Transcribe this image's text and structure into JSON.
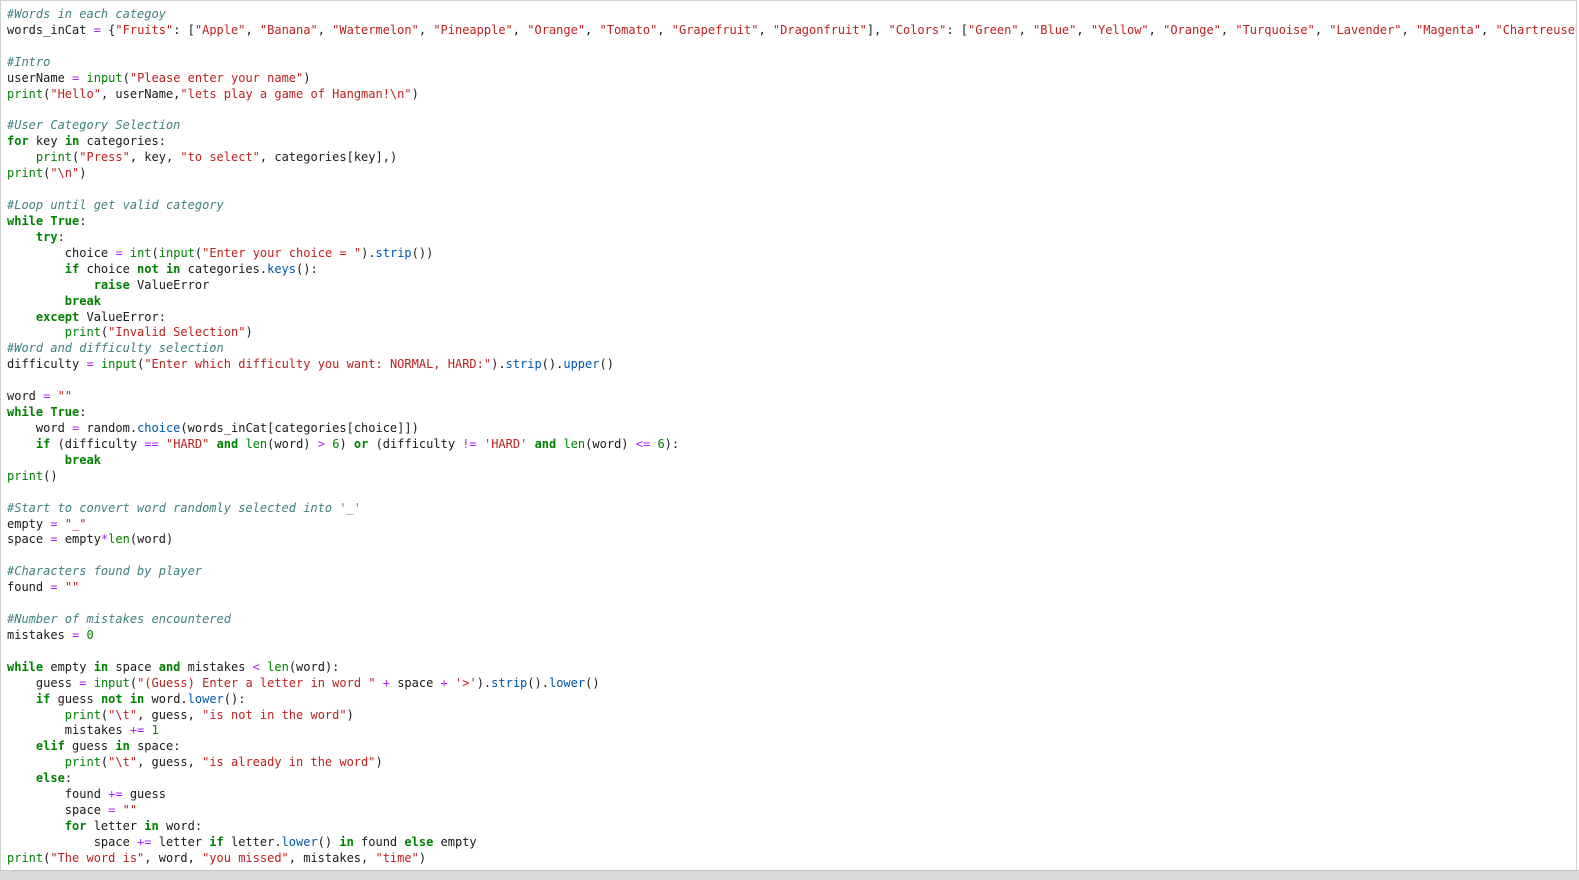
{
  "editor": {
    "lines": [
      [
        [
          "com",
          "#Words in each categoy"
        ]
      ],
      [
        [
          "id",
          "words_inCat "
        ],
        [
          "op",
          "="
        ],
        [
          "id",
          " {"
        ],
        [
          "str",
          "\"Fruits\""
        ],
        [
          "id",
          ": ["
        ],
        [
          "str",
          "\"Apple\""
        ],
        [
          "id",
          ", "
        ],
        [
          "str",
          "\"Banana\""
        ],
        [
          "id",
          ", "
        ],
        [
          "str",
          "\"Watermelon\""
        ],
        [
          "id",
          ", "
        ],
        [
          "str",
          "\"Pineapple\""
        ],
        [
          "id",
          ", "
        ],
        [
          "str",
          "\"Orange\""
        ],
        [
          "id",
          ", "
        ],
        [
          "str",
          "\"Tomato\""
        ],
        [
          "id",
          ", "
        ],
        [
          "str",
          "\"Grapefruit\""
        ],
        [
          "id",
          ", "
        ],
        [
          "str",
          "\"Dragonfruit\""
        ],
        [
          "id",
          "], "
        ],
        [
          "str",
          "\"Colors\""
        ],
        [
          "id",
          ": ["
        ],
        [
          "str",
          "\"Green\""
        ],
        [
          "id",
          ", "
        ],
        [
          "str",
          "\"Blue\""
        ],
        [
          "id",
          ", "
        ],
        [
          "str",
          "\"Yellow\""
        ],
        [
          "id",
          ", "
        ],
        [
          "str",
          "\"Orange\""
        ],
        [
          "id",
          ", "
        ],
        [
          "str",
          "\"Turquoise\""
        ],
        [
          "id",
          ", "
        ],
        [
          "str",
          "\"Lavender\""
        ],
        [
          "id",
          ", "
        ],
        [
          "str",
          "\"Magenta\""
        ],
        [
          "id",
          ", "
        ],
        [
          "str",
          "\"Chartreuse\""
        ],
        [
          "id",
          "]}"
        ]
      ],
      [],
      [
        [
          "com",
          "#Intro"
        ]
      ],
      [
        [
          "id",
          "userName "
        ],
        [
          "op",
          "="
        ],
        [
          "id",
          " "
        ],
        [
          "bi",
          "input"
        ],
        [
          "id",
          "("
        ],
        [
          "str",
          "\"Please enter your name\""
        ],
        [
          "id",
          ")"
        ]
      ],
      [
        [
          "bi",
          "print"
        ],
        [
          "id",
          "("
        ],
        [
          "str",
          "\"Hello\""
        ],
        [
          "id",
          ", userName,"
        ],
        [
          "str",
          "\"lets play a game of Hangman!\\n\""
        ],
        [
          "id",
          ")"
        ]
      ],
      [],
      [
        [
          "com",
          "#User Category Selection"
        ]
      ],
      [
        [
          "kw",
          "for"
        ],
        [
          "id",
          " key "
        ],
        [
          "kw",
          "in"
        ],
        [
          "id",
          " categories:"
        ]
      ],
      [
        [
          "id",
          "    "
        ],
        [
          "bi",
          "print"
        ],
        [
          "id",
          "("
        ],
        [
          "str",
          "\"Press\""
        ],
        [
          "id",
          ", key, "
        ],
        [
          "str",
          "\"to select\""
        ],
        [
          "id",
          ", categories[key],)"
        ]
      ],
      [
        [
          "bi",
          "print"
        ],
        [
          "id",
          "("
        ],
        [
          "str",
          "\"\\n\""
        ],
        [
          "id",
          ")"
        ]
      ],
      [],
      [
        [
          "com",
          "#Loop until get valid category"
        ]
      ],
      [
        [
          "kw",
          "while"
        ],
        [
          "id",
          " "
        ],
        [
          "kw",
          "True"
        ],
        [
          "id",
          ":"
        ]
      ],
      [
        [
          "id",
          "    "
        ],
        [
          "kw",
          "try"
        ],
        [
          "id",
          ":"
        ]
      ],
      [
        [
          "id",
          "        choice "
        ],
        [
          "op",
          "="
        ],
        [
          "id",
          " "
        ],
        [
          "bi",
          "int"
        ],
        [
          "id",
          "("
        ],
        [
          "bi",
          "input"
        ],
        [
          "id",
          "("
        ],
        [
          "str",
          "\"Enter your choice = \""
        ],
        [
          "id",
          ")."
        ],
        [
          "meth",
          "strip"
        ],
        [
          "id",
          "())"
        ]
      ],
      [
        [
          "id",
          "        "
        ],
        [
          "kw",
          "if"
        ],
        [
          "id",
          " choice "
        ],
        [
          "kw",
          "not in"
        ],
        [
          "id",
          " categories."
        ],
        [
          "meth",
          "keys"
        ],
        [
          "id",
          "():"
        ]
      ],
      [
        [
          "id",
          "            "
        ],
        [
          "kw",
          "raise"
        ],
        [
          "id",
          " ValueError"
        ]
      ],
      [
        [
          "id",
          "        "
        ],
        [
          "kw",
          "break"
        ]
      ],
      [
        [
          "id",
          "    "
        ],
        [
          "kw",
          "except"
        ],
        [
          "id",
          " ValueError:"
        ]
      ],
      [
        [
          "id",
          "        "
        ],
        [
          "bi",
          "print"
        ],
        [
          "id",
          "("
        ],
        [
          "str",
          "\"Invalid Selection\""
        ],
        [
          "id",
          ")"
        ]
      ],
      [
        [
          "com",
          "#Word and difficulty selection"
        ]
      ],
      [
        [
          "id",
          "difficulty "
        ],
        [
          "op",
          "="
        ],
        [
          "id",
          " "
        ],
        [
          "bi",
          "input"
        ],
        [
          "id",
          "("
        ],
        [
          "str",
          "\"Enter which difficulty you want: NORMAL, HARD:\""
        ],
        [
          "id",
          ")."
        ],
        [
          "meth",
          "strip"
        ],
        [
          "id",
          "()."
        ],
        [
          "meth",
          "upper"
        ],
        [
          "id",
          "()"
        ]
      ],
      [],
      [
        [
          "id",
          "word "
        ],
        [
          "op",
          "="
        ],
        [
          "id",
          " "
        ],
        [
          "str",
          "\"\""
        ]
      ],
      [
        [
          "kw",
          "while"
        ],
        [
          "id",
          " "
        ],
        [
          "kw",
          "True"
        ],
        [
          "id",
          ":"
        ]
      ],
      [
        [
          "id",
          "    word "
        ],
        [
          "op",
          "="
        ],
        [
          "id",
          " random."
        ],
        [
          "meth",
          "choice"
        ],
        [
          "id",
          "(words_inCat[categories[choice]])"
        ]
      ],
      [
        [
          "id",
          "    "
        ],
        [
          "kw",
          "if"
        ],
        [
          "id",
          " (difficulty "
        ],
        [
          "op",
          "=="
        ],
        [
          "id",
          " "
        ],
        [
          "str",
          "\"HARD\""
        ],
        [
          "id",
          " "
        ],
        [
          "kw",
          "and"
        ],
        [
          "id",
          " "
        ],
        [
          "bi",
          "len"
        ],
        [
          "id",
          "(word) "
        ],
        [
          "op",
          ">"
        ],
        [
          "id",
          " "
        ],
        [
          "num",
          "6"
        ],
        [
          "id",
          ") "
        ],
        [
          "kw",
          "or"
        ],
        [
          "id",
          " (difficulty "
        ],
        [
          "op",
          "!="
        ],
        [
          "id",
          " "
        ],
        [
          "str",
          "'HARD'"
        ],
        [
          "id",
          " "
        ],
        [
          "kw",
          "and"
        ],
        [
          "id",
          " "
        ],
        [
          "bi",
          "len"
        ],
        [
          "id",
          "(word) "
        ],
        [
          "op",
          "<="
        ],
        [
          "id",
          " "
        ],
        [
          "num",
          "6"
        ],
        [
          "id",
          "):"
        ]
      ],
      [
        [
          "id",
          "        "
        ],
        [
          "kw",
          "break"
        ]
      ],
      [
        [
          "bi",
          "print"
        ],
        [
          "id",
          "()"
        ]
      ],
      [],
      [
        [
          "com",
          "#Start to convert word randomly selected into '_'"
        ]
      ],
      [
        [
          "id",
          "empty "
        ],
        [
          "op",
          "="
        ],
        [
          "id",
          " "
        ],
        [
          "str",
          "\"_\""
        ]
      ],
      [
        [
          "id",
          "space "
        ],
        [
          "op",
          "="
        ],
        [
          "id",
          " empty"
        ],
        [
          "op",
          "*"
        ],
        [
          "bi",
          "len"
        ],
        [
          "id",
          "(word)"
        ]
      ],
      [],
      [
        [
          "com",
          "#Characters found by player"
        ]
      ],
      [
        [
          "id",
          "found "
        ],
        [
          "op",
          "="
        ],
        [
          "id",
          " "
        ],
        [
          "str",
          "\"\""
        ]
      ],
      [],
      [
        [
          "com",
          "#Number of mistakes encountered"
        ]
      ],
      [
        [
          "id",
          "mistakes "
        ],
        [
          "op",
          "="
        ],
        [
          "id",
          " "
        ],
        [
          "num",
          "0"
        ]
      ],
      [],
      [
        [
          "kw",
          "while"
        ],
        [
          "id",
          " empty "
        ],
        [
          "kw",
          "in"
        ],
        [
          "id",
          " space "
        ],
        [
          "kw",
          "and"
        ],
        [
          "id",
          " mistakes "
        ],
        [
          "op",
          "<"
        ],
        [
          "id",
          " "
        ],
        [
          "bi",
          "len"
        ],
        [
          "id",
          "(word):"
        ]
      ],
      [
        [
          "id",
          "    guess "
        ],
        [
          "op",
          "="
        ],
        [
          "id",
          " "
        ],
        [
          "bi",
          "input"
        ],
        [
          "id",
          "("
        ],
        [
          "str",
          "\"(Guess) Enter a letter in word \""
        ],
        [
          "id",
          " "
        ],
        [
          "op",
          "+"
        ],
        [
          "id",
          " space "
        ],
        [
          "op",
          "+"
        ],
        [
          "id",
          " "
        ],
        [
          "str",
          "'>'"
        ],
        [
          "id",
          ")."
        ],
        [
          "meth",
          "strip"
        ],
        [
          "id",
          "()."
        ],
        [
          "meth",
          "lower"
        ],
        [
          "id",
          "()"
        ]
      ],
      [
        [
          "id",
          "    "
        ],
        [
          "kw",
          "if"
        ],
        [
          "id",
          " guess "
        ],
        [
          "kw",
          "not in"
        ],
        [
          "id",
          " word."
        ],
        [
          "meth",
          "lower"
        ],
        [
          "id",
          "():"
        ]
      ],
      [
        [
          "id",
          "        "
        ],
        [
          "bi",
          "print"
        ],
        [
          "id",
          "("
        ],
        [
          "str",
          "\"\\t\""
        ],
        [
          "id",
          ", guess, "
        ],
        [
          "str",
          "\"is not in the word\""
        ],
        [
          "id",
          ")"
        ]
      ],
      [
        [
          "id",
          "        mistakes "
        ],
        [
          "op",
          "+="
        ],
        [
          "id",
          " "
        ],
        [
          "num",
          "1"
        ]
      ],
      [
        [
          "id",
          "    "
        ],
        [
          "kw",
          "elif"
        ],
        [
          "id",
          " guess "
        ],
        [
          "kw",
          "in"
        ],
        [
          "id",
          " space:"
        ]
      ],
      [
        [
          "id",
          "        "
        ],
        [
          "bi",
          "print"
        ],
        [
          "id",
          "("
        ],
        [
          "str",
          "\"\\t\""
        ],
        [
          "id",
          ", guess, "
        ],
        [
          "str",
          "\"is already in the word\""
        ],
        [
          "id",
          ")"
        ]
      ],
      [
        [
          "id",
          "    "
        ],
        [
          "kw",
          "else"
        ],
        [
          "id",
          ":"
        ]
      ],
      [
        [
          "id",
          "        found "
        ],
        [
          "op",
          "+="
        ],
        [
          "id",
          " guess"
        ]
      ],
      [
        [
          "id",
          "        space "
        ],
        [
          "op",
          "="
        ],
        [
          "id",
          " "
        ],
        [
          "str",
          "\"\""
        ]
      ],
      [
        [
          "id",
          "        "
        ],
        [
          "kw",
          "for"
        ],
        [
          "id",
          " letter "
        ],
        [
          "kw",
          "in"
        ],
        [
          "id",
          " word:"
        ]
      ],
      [
        [
          "id",
          "            space "
        ],
        [
          "op",
          "+="
        ],
        [
          "id",
          " letter "
        ],
        [
          "kw",
          "if"
        ],
        [
          "id",
          " letter."
        ],
        [
          "meth",
          "lower"
        ],
        [
          "id",
          "() "
        ],
        [
          "kw",
          "in"
        ],
        [
          "id",
          " found "
        ],
        [
          "kw",
          "else"
        ],
        [
          "id",
          " empty"
        ]
      ],
      [
        [
          "bi",
          "print"
        ],
        [
          "id",
          "("
        ],
        [
          "str",
          "\"The word is\""
        ],
        [
          "id",
          ", word, "
        ],
        [
          "str",
          "\"you missed\""
        ],
        [
          "id",
          ", mistakes, "
        ],
        [
          "str",
          "\"time\""
        ],
        [
          "id",
          ")"
        ]
      ]
    ]
  }
}
